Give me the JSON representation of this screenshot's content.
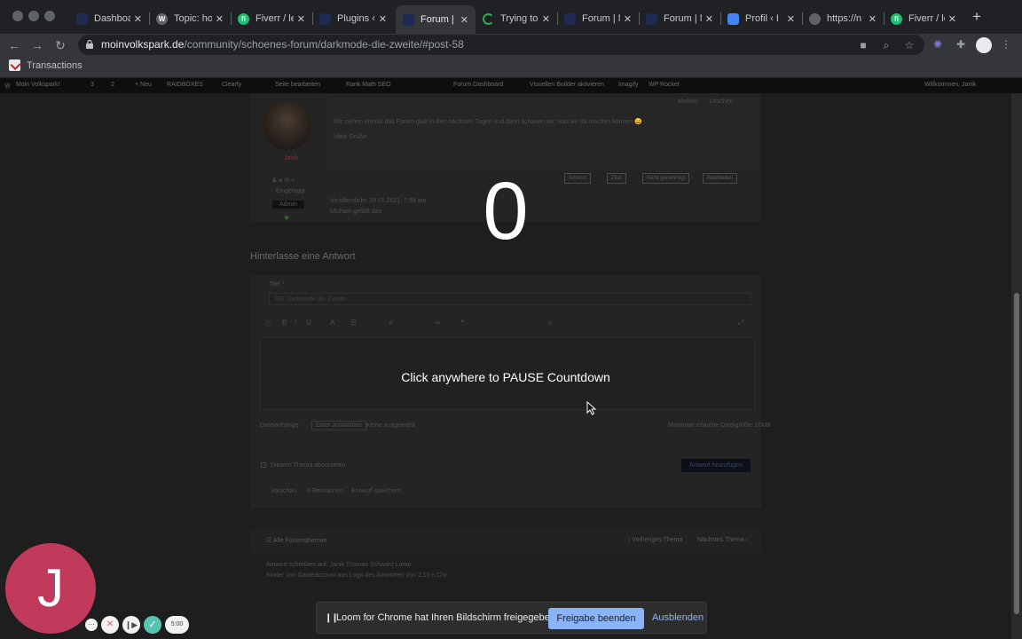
{
  "tabs": [
    {
      "title": "Dashboard",
      "icon": "wordpress-dashboard-icon",
      "color": "#1e2a52"
    },
    {
      "title": "Topic: ho",
      "icon": "wordpress-icon",
      "color": "#5f6368"
    },
    {
      "title": "Fiverr / le",
      "icon": "fiverr-icon",
      "color": "#1dbf73"
    },
    {
      "title": "Plugins ‹",
      "icon": "wordpress-dashboard-icon",
      "color": "#1e2a52"
    },
    {
      "title": "Forum | M",
      "icon": "wordpress-dashboard-icon",
      "color": "#1e2a52"
    },
    {
      "title": "Trying to",
      "icon": "loading-icon",
      "color": "#34a853"
    },
    {
      "title": "Forum | M",
      "icon": "wordpress-dashboard-icon",
      "color": "#1e2a52"
    },
    {
      "title": "Forum | M",
      "icon": "wordpress-dashboard-icon",
      "color": "#1e2a52"
    },
    {
      "title": "Profil ‹ I",
      "icon": "profile-icon",
      "color": "#4285f4"
    },
    {
      "title": "https://n",
      "icon": "globe-icon",
      "color": "#5f6368"
    },
    {
      "title": "Fiverr / le",
      "icon": "fiverr-icon",
      "color": "#1dbf73"
    }
  ],
  "new_tab": "+",
  "address": {
    "host": "moinvolkspark.de",
    "path": "/community/schoenes-forum/darkmode-die-zweite/#post-58"
  },
  "bookmarks": [
    {
      "label": "Transactions"
    }
  ],
  "wp_admin": [
    "Moin Volkspark!",
    "3",
    "2",
    "+ Neu",
    "RAIDBOXES",
    "Clearfy",
    "Seite bearbeiten",
    "Rank Math SEO",
    "Forum Dashboard",
    "Visuellen Builder aktivieren",
    "Imagify",
    "WP Rocket",
    "Willkommen, Janik"
  ],
  "post": {
    "actions": [
      "Melden",
      "Löschen"
    ],
    "text": "Wir ziehen einmal das Forum glatt in den nächsten Tagen und dann schauen wir, was wir da machen können 😀",
    "greeting": "Viele Grüße",
    "author": "Janik",
    "author_status": "Eingeloggt",
    "role": "Admin",
    "buttons": [
      "Antwort",
      "Zitat",
      "Nicht genehmigt",
      "Bearbeiten"
    ],
    "meta_1": "Veröffentlicht: 29.01.2021, 7:59 am",
    "meta_2": "Michael gefällt das"
  },
  "reply": {
    "heading": "Hinterlasse eine Antwort",
    "title_label": "Titel *",
    "title_value": "RE: Darkmode die Zweite",
    "attach_label": "Dateianhänge:",
    "attach_button": "Datei auswählen",
    "attach_none": "Keine ausgewählt",
    "max_size": "Maximale erlaubte Dateigröße: 10MB",
    "subscribe": "Diesem Thema abonnieren",
    "submit": "Antwort hinzufügen",
    "links": [
      "Vorschau",
      "0 Revisionen",
      "Entwurf speichern"
    ]
  },
  "topic_nav": {
    "all": "Alle Forumsthemen",
    "prev": "Vorheriges Thema",
    "next": "Nächstes Thema"
  },
  "footer_line_1": "Antwort schreiben auf: Janik Thomas Schwarz Lamp",
  "footer_line_2": "Kinder von Gästeaccount aus Logo des Antworten von 2:10 n.Chr.",
  "countdown": {
    "number": "0",
    "message": "Click anywhere to PAUSE Countdown"
  },
  "loom": {
    "message": "Loom for Chrome hat Ihren Bildschirm freigegeben.",
    "stop": "Freigabe beenden",
    "hide": "Ausblenden"
  },
  "recorder": {
    "initial": "J",
    "timer": "5:00",
    "accent": "#c23a5b"
  }
}
